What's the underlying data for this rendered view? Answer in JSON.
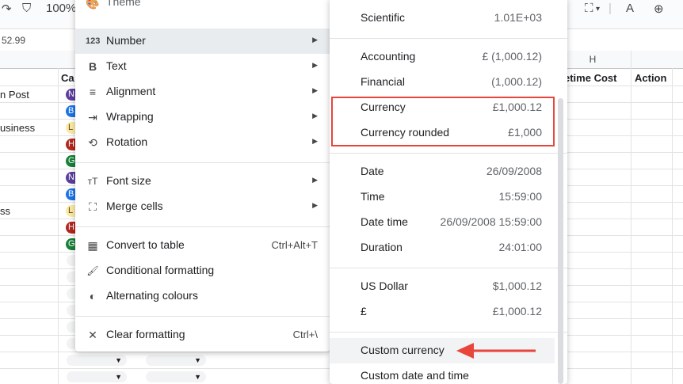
{
  "toolbar": {
    "zoom": "100%"
  },
  "formula_bar": {
    "value": "52.99"
  },
  "sheet": {
    "col_h_letter": "H",
    "headers": {
      "category_partial": "Ca",
      "lifetime_cost": "etime Cost",
      "action": "Action"
    },
    "row_labels": [
      "n Post",
      "usiness",
      "ss"
    ],
    "chip_letters": [
      "N",
      "B",
      "L",
      "H",
      "G",
      "N",
      "B",
      "L",
      "H",
      "G"
    ],
    "chip_colors": [
      "#5b3e9c",
      "#1a73e8",
      "#fbe9a8",
      "#b3261e",
      "#188038",
      "#5b3e9c",
      "#1a73e8",
      "#fbe9a8",
      "#b3261e",
      "#188038"
    ]
  },
  "menu": {
    "theme_partial": "Theme",
    "items": [
      {
        "icon": "123",
        "label": "Number",
        "submenu_arrow": "▶"
      },
      {
        "icon": "B",
        "label": "Text",
        "submenu_arrow": "▶"
      },
      {
        "icon": "≡",
        "label": "Alignment",
        "submenu_arrow": "▶"
      },
      {
        "icon": "⇥",
        "label": "Wrapping",
        "submenu_arrow": "▶"
      },
      {
        "icon": "⟲",
        "label": "Rotation",
        "submenu_arrow": "▶"
      },
      {
        "icon": "тT",
        "label": "Font size",
        "submenu_arrow": "▶"
      },
      {
        "icon": "⛶",
        "label": "Merge cells",
        "submenu_arrow": "▶"
      },
      {
        "icon": "▦",
        "label": "Convert to table",
        "shortcut": "Ctrl+Alt+T"
      },
      {
        "icon": "🖌",
        "label": "Conditional formatting"
      },
      {
        "icon": "◐",
        "label": "Alternating colours"
      },
      {
        "icon": "✕",
        "label": "Clear formatting",
        "shortcut": "Ctrl+\\"
      }
    ]
  },
  "number_submenu": {
    "items": [
      {
        "label": "Scientific",
        "value": "1.01E+03"
      },
      {
        "label": "Accounting",
        "value": "£ (1,000.12)"
      },
      {
        "label": "Financial",
        "value": "(1,000.12)"
      },
      {
        "label": "Currency",
        "value": "£1,000.12"
      },
      {
        "label": "Currency rounded",
        "value": "£1,000"
      },
      {
        "label": "Date",
        "value": "26/09/2008"
      },
      {
        "label": "Time",
        "value": "15:59:00"
      },
      {
        "label": "Date time",
        "value": "26/09/2008 15:59:00"
      },
      {
        "label": "Duration",
        "value": "24:01:00"
      },
      {
        "label": "US Dollar",
        "value": "$1,000.12"
      },
      {
        "label": "£",
        "value": "£1,000.12"
      },
      {
        "label": "Custom currency",
        "value": ""
      },
      {
        "label": "Custom date and time",
        "value": ""
      }
    ]
  },
  "annotation_colors": {
    "highlight": "#e8453c"
  }
}
